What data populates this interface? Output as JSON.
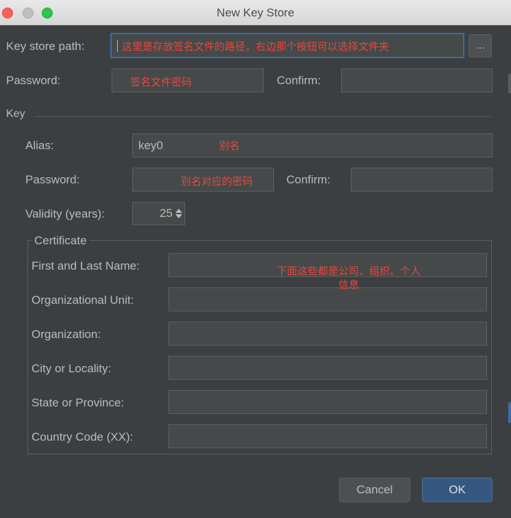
{
  "window": {
    "title": "New Key Store"
  },
  "keystore": {
    "path_label": "Key store path:",
    "path_annotation": "这里是存放签名文件的路径，右边那个按钮可以选择文件夹",
    "browse_label": "...",
    "password_label": "Password:",
    "password_annotation": "签名文件密码",
    "confirm_label": "Confirm:"
  },
  "key": {
    "section_label": "Key",
    "alias_label": "Alias:",
    "alias_value": "key0",
    "alias_annotation": "别名",
    "password_label": "Password:",
    "password_annotation": "别名对应的密码",
    "confirm_label": "Confirm:",
    "validity_label": "Validity (years):",
    "validity_value": "25"
  },
  "certificate": {
    "legend": "Certificate",
    "annotation_line1": "下面这些都是公司、组织、个人",
    "annotation_line2": "信息",
    "fields": [
      {
        "label": "First and Last Name:"
      },
      {
        "label": "Organizational Unit:"
      },
      {
        "label": "Organization:"
      },
      {
        "label": "City or Locality:"
      },
      {
        "label": "State or Province:"
      },
      {
        "label": "Country Code (XX):"
      }
    ]
  },
  "buttons": {
    "cancel": "Cancel",
    "ok": "OK"
  },
  "colors": {
    "background": "#3c3f41",
    "field": "#45494a",
    "focus_border": "#3d6da2",
    "annotation": "#e8483c",
    "ok_button": "#365880"
  }
}
